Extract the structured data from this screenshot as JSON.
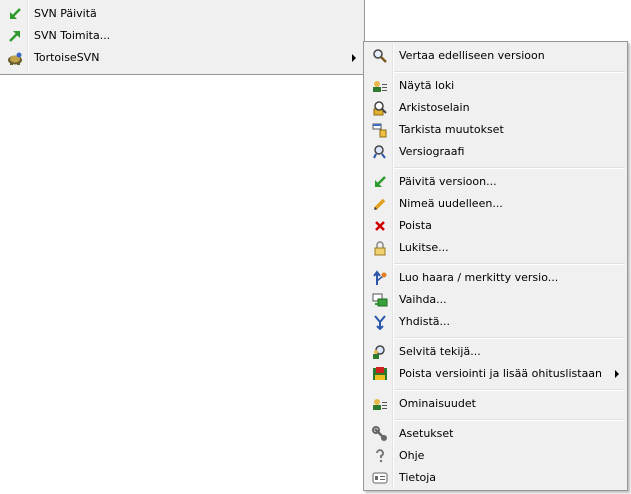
{
  "main_menu": {
    "items": [
      {
        "label": "SVN Päivitä",
        "icon": "svn-update-icon"
      },
      {
        "label": "SVN Toimita...",
        "icon": "svn-commit-icon"
      },
      {
        "label": "TortoiseSVN",
        "icon": "tortoisesvn-icon",
        "submenu": true
      }
    ]
  },
  "submenu": {
    "items": [
      {
        "label": "Vertaa edelliseen versioon",
        "icon": "diff-icon"
      },
      {
        "label": "Näytä loki",
        "icon": "log-icon"
      },
      {
        "label": "Arkistoselain",
        "icon": "repo-browser-icon"
      },
      {
        "label": "Tarkista muutokset",
        "icon": "check-modifications-icon"
      },
      {
        "label": "Versiograafi",
        "icon": "revision-graph-icon"
      },
      {
        "label": "Päivitä versioon...",
        "icon": "update-to-revision-icon"
      },
      {
        "label": "Nimeä uudelleen...",
        "icon": "rename-icon"
      },
      {
        "label": "Poista",
        "icon": "delete-icon"
      },
      {
        "label": "Lukitse...",
        "icon": "lock-icon"
      },
      {
        "label": "Luo haara / merkitty versio...",
        "icon": "branch-tag-icon"
      },
      {
        "label": "Vaihda...",
        "icon": "switch-icon"
      },
      {
        "label": "Yhdistä...",
        "icon": "merge-icon"
      },
      {
        "label": "Selvitä tekijä...",
        "icon": "blame-icon"
      },
      {
        "label": "Poista versiointi ja lisää ohituslistaan",
        "icon": "unversion-ignore-icon",
        "submenu": true
      },
      {
        "label": "Ominaisuudet",
        "icon": "properties-icon"
      },
      {
        "label": "Asetukset",
        "icon": "settings-icon"
      },
      {
        "label": "Ohje",
        "icon": "help-icon"
      },
      {
        "label": "Tietoja",
        "icon": "about-icon"
      }
    ]
  },
  "colors": {
    "menu_bg": "#f0f0f0",
    "border": "#979797",
    "update_green": "#2e9a2e",
    "delete_red": "#d00000"
  }
}
